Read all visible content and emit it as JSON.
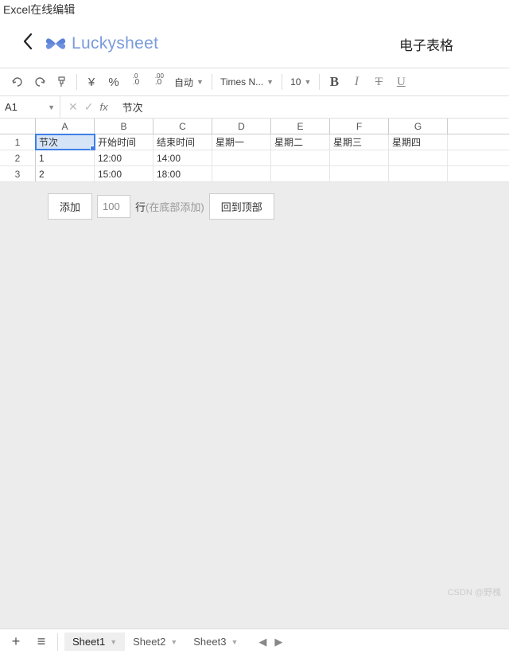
{
  "window_title": "Excel在线编辑",
  "header": {
    "logo_text": "Luckysheet",
    "doc_title": "电子表格"
  },
  "toolbar": {
    "currency": "¥",
    "percent": "%",
    "dec_dec": ".0←",
    "dec_inc": ".00→",
    "format_label": "自动",
    "font_label": "Times N...",
    "font_size": "10",
    "bold": "B",
    "italic": "I",
    "strike": "T",
    "underline": "U"
  },
  "formula_bar": {
    "name_box": "A1",
    "fx_label": "fx",
    "fx_value": "节次"
  },
  "columns": [
    "A",
    "B",
    "C",
    "D",
    "E",
    "F",
    "G"
  ],
  "rows": [
    {
      "n": "1",
      "cells": [
        "节次",
        "开始时间",
        "结束时间",
        "星期一",
        "星期二",
        "星期三",
        "星期四"
      ]
    },
    {
      "n": "2",
      "cells": [
        "1",
        "12:00",
        "14:00",
        "",
        "",
        "",
        ""
      ]
    },
    {
      "n": "3",
      "cells": [
        "2",
        "15:00",
        "18:00",
        "",
        "",
        "",
        ""
      ]
    }
  ],
  "selected": {
    "row": 0,
    "col": 0
  },
  "add_bar": {
    "add_btn": "添加",
    "count": "100",
    "rows_word": "行",
    "at_bottom": "(在底部添加)",
    "back_top": "回到顶部"
  },
  "sheets": {
    "active": 0,
    "items": [
      "Sheet1",
      "Sheet2",
      "Sheet3"
    ]
  },
  "watermark": "CSDN @野槐"
}
